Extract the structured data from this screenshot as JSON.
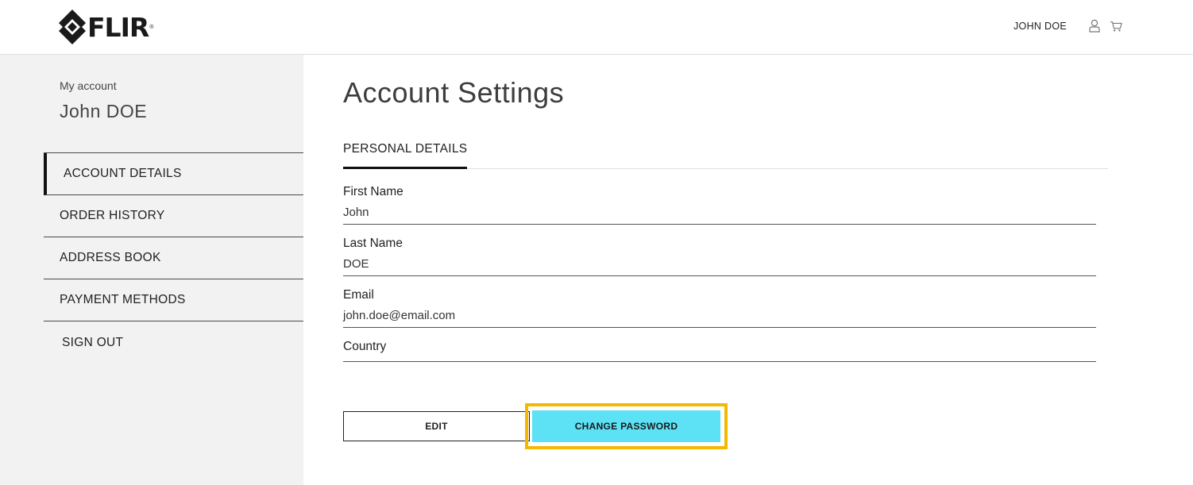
{
  "header": {
    "logo_text": "FLIR",
    "logo_reg": "®",
    "user_name": "JOHN DOE",
    "icons": [
      "user-icon",
      "cart-icon"
    ]
  },
  "sidebar": {
    "subtitle": "My account",
    "name": "John DOE",
    "items": [
      {
        "label": "ACCOUNT DETAILS",
        "active": true
      },
      {
        "label": "ORDER HISTORY",
        "active": false
      },
      {
        "label": "ADDRESS BOOK",
        "active": false
      },
      {
        "label": "PAYMENT METHODS",
        "active": false
      },
      {
        "label": "SIGN OUT",
        "active": false
      }
    ]
  },
  "main": {
    "title": "Account Settings",
    "tab": "PERSONAL DETAILS",
    "fields": [
      {
        "label": "First Name",
        "value": "John"
      },
      {
        "label": "Last Name",
        "value": "DOE"
      },
      {
        "label": "Email",
        "value": "john.doe@email.com"
      },
      {
        "label": "Country",
        "value": ""
      }
    ],
    "edit_label": "EDIT",
    "change_password_label": "CHANGE PASSWORD"
  },
  "colors": {
    "accent_button": "#5ce1f5",
    "highlight_border": "#f5b800",
    "sidebar_bg": "#f2f2f2"
  }
}
